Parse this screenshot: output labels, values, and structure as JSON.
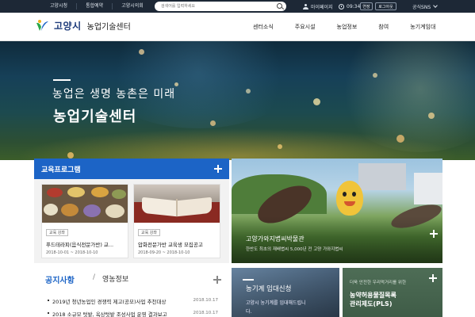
{
  "topbar": {
    "links": [
      "고양시청",
      "통합예약",
      "고양시의회"
    ],
    "search_placeholder": "검색어를 입력하세요",
    "mypage_label": "마이페이지",
    "time": "09:34",
    "extend_label": "연장",
    "logout_label": "로그아웃",
    "sns_label": "공식SNS"
  },
  "header": {
    "logo_city": "고양시",
    "logo_center": "농업기술센터",
    "nav": [
      "센터소식",
      "주요시설",
      "농업정보",
      "참여",
      "농기계임대"
    ]
  },
  "hero": {
    "slogan": "농업은 생명 농촌은 미래",
    "title": "농업기술센터"
  },
  "education": {
    "title": "교육프로그램",
    "cards": [
      {
        "tag": "교육 강좌",
        "title": "푸드테라피(음식전문가반) 교...",
        "dates": "2018-10-01 ~ 2018-10-10"
      },
      {
        "tag": "교육 강좌",
        "title": "압화전문가반 교육생 모집공고",
        "dates": "2018-09-20 ~ 2018-10-10"
      }
    ]
  },
  "museum": {
    "title": "고양가와지볍씨박물관",
    "description": "한반도 최초의 재배볍씨 5,000년 전 고양 가와지볍씨"
  },
  "notice": {
    "tab_active": "공지사항",
    "separator": "/",
    "tab_other": "영농정보",
    "items": [
      {
        "title": "2019년 청년농업인 경쟁력 제고(공모)사업 추천대상",
        "date": "2018.10.17"
      },
      {
        "title": "2018 소규모 텃밭, 옥상텃밭 조성사업 운영 결과보고",
        "date": "2018.10.17"
      }
    ]
  },
  "lease": {
    "title": "농기계 임대신청",
    "description": "고양시 농기계를 임대해드립니다."
  },
  "pls": {
    "description": "더욱 안전한 우리먹거리를 위한",
    "title_line1": "농약허용물질목록",
    "title_line2": "관리제도(PLS)"
  },
  "colors": {
    "topbar": "#1d2836",
    "brand_blue": "#1c64c6",
    "logo_navy": "#1d3b7a"
  }
}
